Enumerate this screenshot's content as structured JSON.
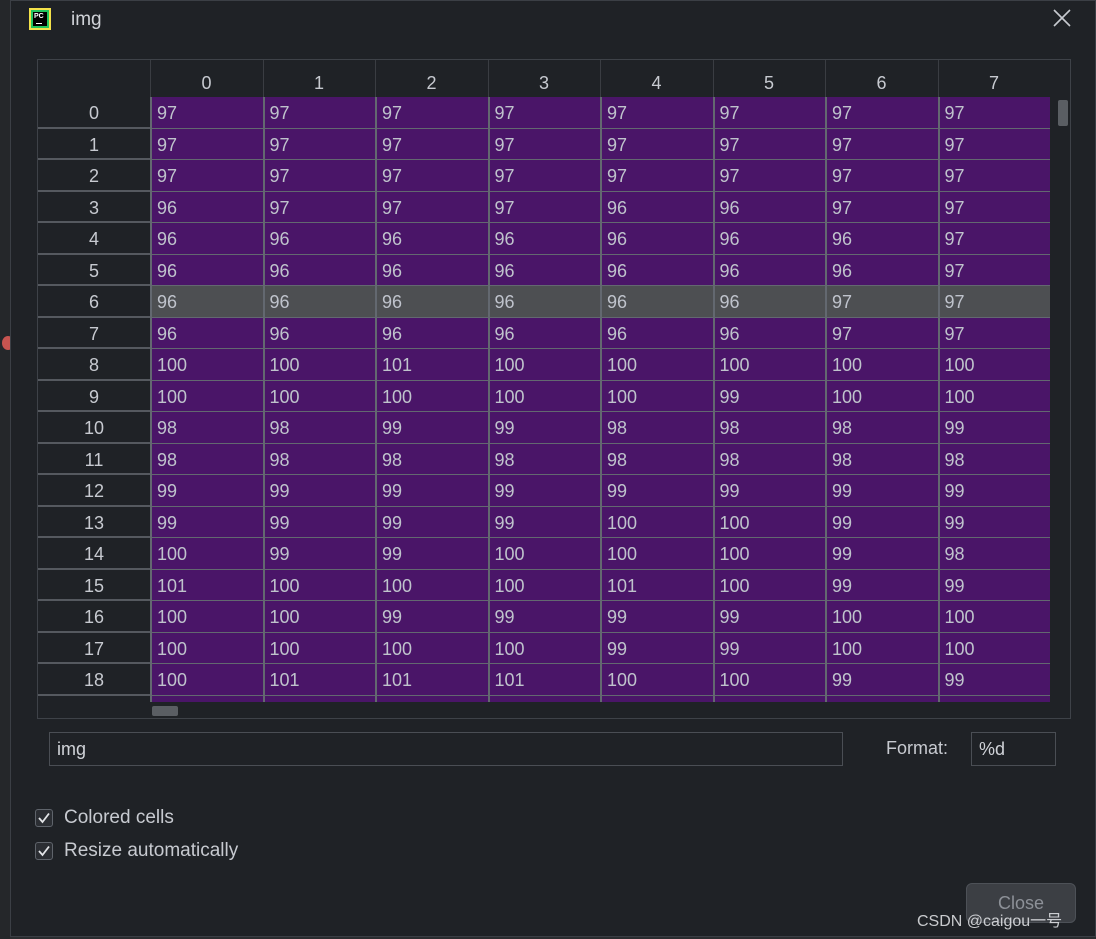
{
  "window": {
    "title": "img"
  },
  "grid": {
    "columns": [
      "0",
      "1",
      "2",
      "3",
      "4",
      "5",
      "6",
      "7"
    ],
    "selected_row": 6,
    "rows": [
      {
        "label": "0",
        "cells": [
          "97",
          "97",
          "97",
          "97",
          "97",
          "97",
          "97",
          "97"
        ]
      },
      {
        "label": "1",
        "cells": [
          "97",
          "97",
          "97",
          "97",
          "97",
          "97",
          "97",
          "97"
        ]
      },
      {
        "label": "2",
        "cells": [
          "97",
          "97",
          "97",
          "97",
          "97",
          "97",
          "97",
          "97"
        ]
      },
      {
        "label": "3",
        "cells": [
          "96",
          "97",
          "97",
          "97",
          "96",
          "96",
          "97",
          "97"
        ]
      },
      {
        "label": "4",
        "cells": [
          "96",
          "96",
          "96",
          "96",
          "96",
          "96",
          "96",
          "97"
        ]
      },
      {
        "label": "5",
        "cells": [
          "96",
          "96",
          "96",
          "96",
          "96",
          "96",
          "96",
          "97"
        ]
      },
      {
        "label": "6",
        "cells": [
          "96",
          "96",
          "96",
          "96",
          "96",
          "96",
          "97",
          "97"
        ]
      },
      {
        "label": "7",
        "cells": [
          "96",
          "96",
          "96",
          "96",
          "96",
          "96",
          "97",
          "97"
        ]
      },
      {
        "label": "8",
        "cells": [
          "100",
          "100",
          "101",
          "100",
          "100",
          "100",
          "100",
          "100"
        ]
      },
      {
        "label": "9",
        "cells": [
          "100",
          "100",
          "100",
          "100",
          "100",
          "99",
          "100",
          "100"
        ]
      },
      {
        "label": "10",
        "cells": [
          "98",
          "98",
          "99",
          "99",
          "98",
          "98",
          "98",
          "99"
        ]
      },
      {
        "label": "11",
        "cells": [
          "98",
          "98",
          "98",
          "98",
          "98",
          "98",
          "98",
          "98"
        ]
      },
      {
        "label": "12",
        "cells": [
          "99",
          "99",
          "99",
          "99",
          "99",
          "99",
          "99",
          "99"
        ]
      },
      {
        "label": "13",
        "cells": [
          "99",
          "99",
          "99",
          "99",
          "100",
          "100",
          "99",
          "99"
        ]
      },
      {
        "label": "14",
        "cells": [
          "100",
          "99",
          "99",
          "100",
          "100",
          "100",
          "99",
          "98"
        ]
      },
      {
        "label": "15",
        "cells": [
          "101",
          "100",
          "100",
          "100",
          "101",
          "100",
          "99",
          "99"
        ]
      },
      {
        "label": "16",
        "cells": [
          "100",
          "100",
          "99",
          "99",
          "99",
          "99",
          "100",
          "100"
        ]
      },
      {
        "label": "17",
        "cells": [
          "100",
          "100",
          "100",
          "100",
          "99",
          "99",
          "100",
          "100"
        ]
      },
      {
        "label": "18",
        "cells": [
          "100",
          "101",
          "101",
          "101",
          "100",
          "100",
          "99",
          "99"
        ]
      },
      {
        "label": "",
        "cells": [
          "",
          "",
          "",
          "",
          "",
          "",
          "",
          ""
        ]
      }
    ]
  },
  "name_field": {
    "value": "img"
  },
  "format": {
    "label": "Format:",
    "value": "%d"
  },
  "options": {
    "colored_cells": {
      "label": "Colored cells",
      "checked": true
    },
    "resize_automatically": {
      "label": "Resize automatically",
      "checked": true
    }
  },
  "close_button": {
    "label": "Close"
  },
  "watermark": "CSDN @caigou一号",
  "colors": {
    "cell_fill": "#4a1568",
    "selected_row_fill": "#4d4f52",
    "dialog_bg": "#1f2226"
  },
  "icons": {
    "app": "pycharm-icon",
    "close": "close-icon",
    "check": "check-icon"
  }
}
